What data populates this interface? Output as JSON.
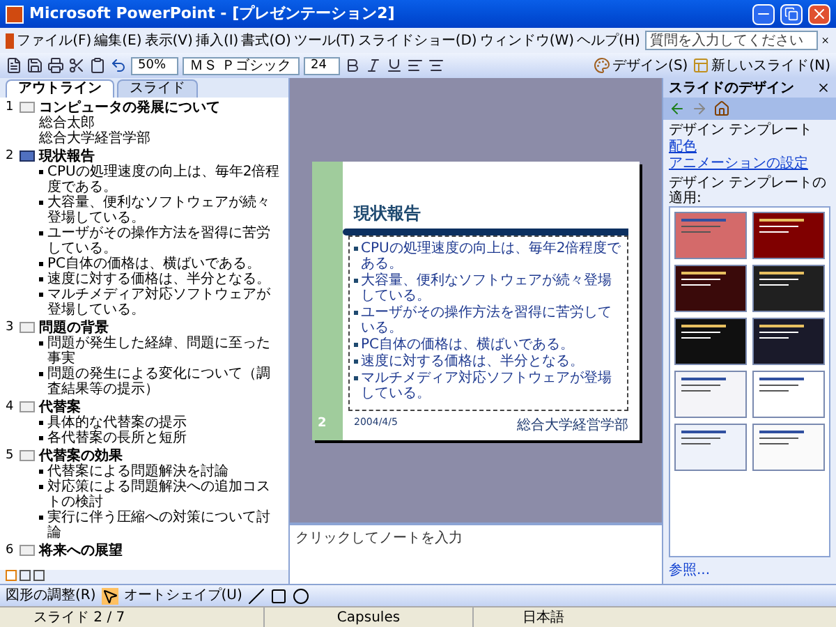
{
  "window": {
    "title": "Microsoft PowerPoint - [プレゼンテーション2]"
  },
  "menu": [
    "ファイル(F)",
    "編集(E)",
    "表示(V)",
    "挿入(I)",
    "書式(O)",
    "ツール(T)",
    "スライドショー(D)",
    "ウィンドウ(W)",
    "ヘルプ(H)"
  ],
  "help_search": {
    "placeholder": "質問を入力してください"
  },
  "toolbar": {
    "zoom": "50%",
    "font": "ＭＳ Ｐゴシック",
    "font_size": "24",
    "buttons": [
      "デザイン(S)",
      "新しいスライド(N)"
    ]
  },
  "left_pane": {
    "tabs": [
      {
        "label": "アウトライン",
        "selected": true
      },
      {
        "label": "スライド",
        "selected": false
      }
    ],
    "outline": [
      {
        "number": "1",
        "title": "コンピュータの発展について",
        "selected": false,
        "lines": [
          {
            "kind": "plain",
            "text": "総合太郎"
          },
          {
            "kind": "plain",
            "text": "総合大学経営学部"
          }
        ]
      },
      {
        "number": "2",
        "title": "現状報告",
        "selected": true,
        "lines": [
          {
            "kind": "bullet",
            "text": "CPUの処理速度の向上は、毎年2倍程度である。"
          },
          {
            "kind": "bullet",
            "text": "大容量、便利なソフトウェアが続々登場している。"
          },
          {
            "kind": "bullet",
            "text": "ユーザがその操作方法を習得に苦労している。"
          },
          {
            "kind": "bullet",
            "text": "PC自体の価格は、横ばいである。"
          },
          {
            "kind": "bullet",
            "text": "速度に対する価格は、半分となる。"
          },
          {
            "kind": "bullet",
            "text": "マルチメディア対応ソフトウェアが登場している。"
          }
        ]
      },
      {
        "number": "3",
        "title": "問題の背景",
        "selected": false,
        "lines": [
          {
            "kind": "bullet",
            "text": "問題が発生した経緯、問題に至った事実"
          },
          {
            "kind": "bullet",
            "text": "問題の発生による変化について（調査結果等の提示）"
          }
        ]
      },
      {
        "number": "4",
        "title": "代替案",
        "selected": false,
        "lines": [
          {
            "kind": "bullet",
            "text": "具体的な代替案の提示"
          },
          {
            "kind": "bullet",
            "text": "各代替案の長所と短所"
          }
        ]
      },
      {
        "number": "5",
        "title": "代替案の効果",
        "selected": false,
        "lines": [
          {
            "kind": "bullet",
            "text": "代替案による問題解決を討論"
          },
          {
            "kind": "bullet",
            "text": "対応策による問題解決への追加コストの検討"
          },
          {
            "kind": "bullet",
            "text": "実行に伴う圧縮への対策について討論"
          }
        ]
      },
      {
        "number": "6",
        "title": "将来への展望",
        "selected": false
      }
    ]
  },
  "slide": {
    "title": "現状報告",
    "bullets": [
      "CPUの処理速度の向上は、毎年2倍程度である。",
      "大容量、便利なソフトウェアが続々登場している。",
      "ユーザがその操作方法を習得に苦労している。",
      "PC自体の価格は、横ばいである。",
      "速度に対する価格は、半分となる。",
      "マルチメディア対応ソフトウェアが登場している。"
    ],
    "number": "2",
    "date": "2004/4/5",
    "footer": "総合大学経営学部"
  },
  "notes": {
    "placeholder": "クリックしてノートを入力"
  },
  "task_pane": {
    "title": "スライドのデザイン",
    "links": [
      {
        "label": "デザイン テンプレート",
        "current": true
      },
      {
        "label": "配色",
        "current": false
      },
      {
        "label": "アニメーションの設定",
        "current": false
      }
    ],
    "section": "デザイン テンプレートの適用:",
    "templates": [
      {
        "color": "#d46a6a"
      },
      {
        "color": "#800000"
      },
      {
        "color": "#3a0a0a"
      },
      {
        "color": "#202020"
      },
      {
        "color": "#101010"
      },
      {
        "color": "#1a1a2a"
      },
      {
        "color": "#f4f4f8"
      },
      {
        "color": "#ffffff"
      },
      {
        "color": "#eef2fa"
      },
      {
        "color": "#fafafa"
      }
    ],
    "more": "参照..."
  },
  "drawing_toolbar": {
    "buttons": [
      "図形の調整(R)",
      "オートシェイプ(U)"
    ]
  },
  "status_bar": {
    "slide": "スライド 2 / 7",
    "design": "Capsules",
    "language": "日本語"
  }
}
